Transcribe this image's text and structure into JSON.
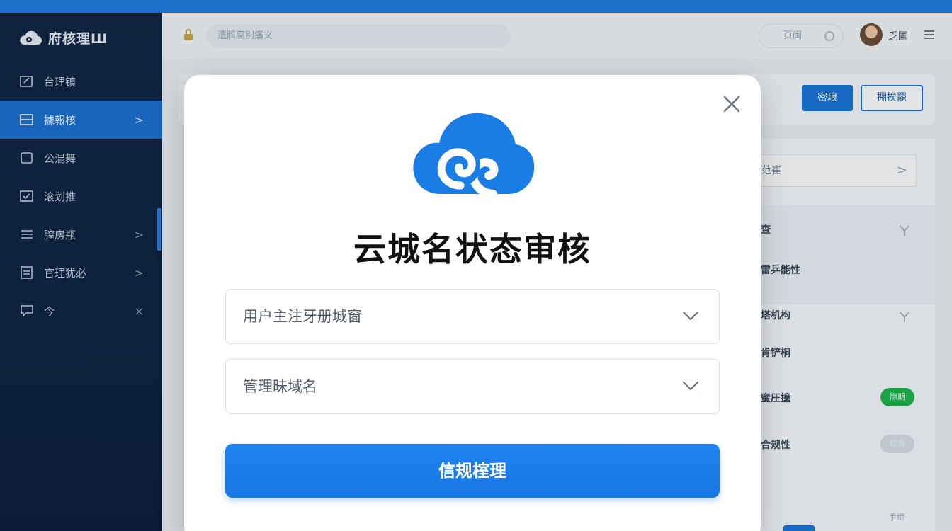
{
  "app": {
    "brand_name": "府核理Ш",
    "accent_color": "#1e7be0"
  },
  "sidebar": {
    "items": [
      {
        "label": "台理镇",
        "icon": "edit-icon",
        "has_chevron": false
      },
      {
        "label": "據報核",
        "icon": "server-icon",
        "has_chevron": true,
        "active": true
      },
      {
        "label": "公混舞",
        "icon": "square-icon",
        "has_chevron": false
      },
      {
        "label": "滚划推",
        "icon": "checklist-icon",
        "has_chevron": false
      },
      {
        "label": "膣房瓶",
        "icon": "list-icon",
        "has_chevron": true
      },
      {
        "label": "官理犹必",
        "icon": "document-icon",
        "has_chevron": true
      },
      {
        "label": "今",
        "icon": "chat-icon",
        "has_chevron": false,
        "close": true
      }
    ],
    "chevron_glyph": ">",
    "close_glyph": "×"
  },
  "header": {
    "search_placeholder": "遗髌腐別痛义",
    "status_label": "页闽",
    "user_name": "乏圃"
  },
  "background_page": {
    "primary_button": "密琅",
    "outline_button": "掤挨罷",
    "filter_placeholder": "范崔",
    "rows": [
      {
        "label": "查"
      },
      {
        "label": "雷乒能性"
      },
      {
        "label": "塔机构"
      },
      {
        "label": "肯铲桐"
      },
      {
        "label": "蜜圧撞",
        "tag": "隙期",
        "tag_color": "#1fb34a"
      },
      {
        "label": "合规性",
        "tag": "联准",
        "tag_color": "#d9dee5"
      }
    ],
    "footer_text": "手组"
  },
  "modal": {
    "title": "云城名状态审核",
    "select_1_placeholder": "用户主注牙册城窗",
    "select_2_placeholder": "管理昧域名",
    "submit_label": "信规榁理",
    "logo_color": "#1a7de6"
  }
}
